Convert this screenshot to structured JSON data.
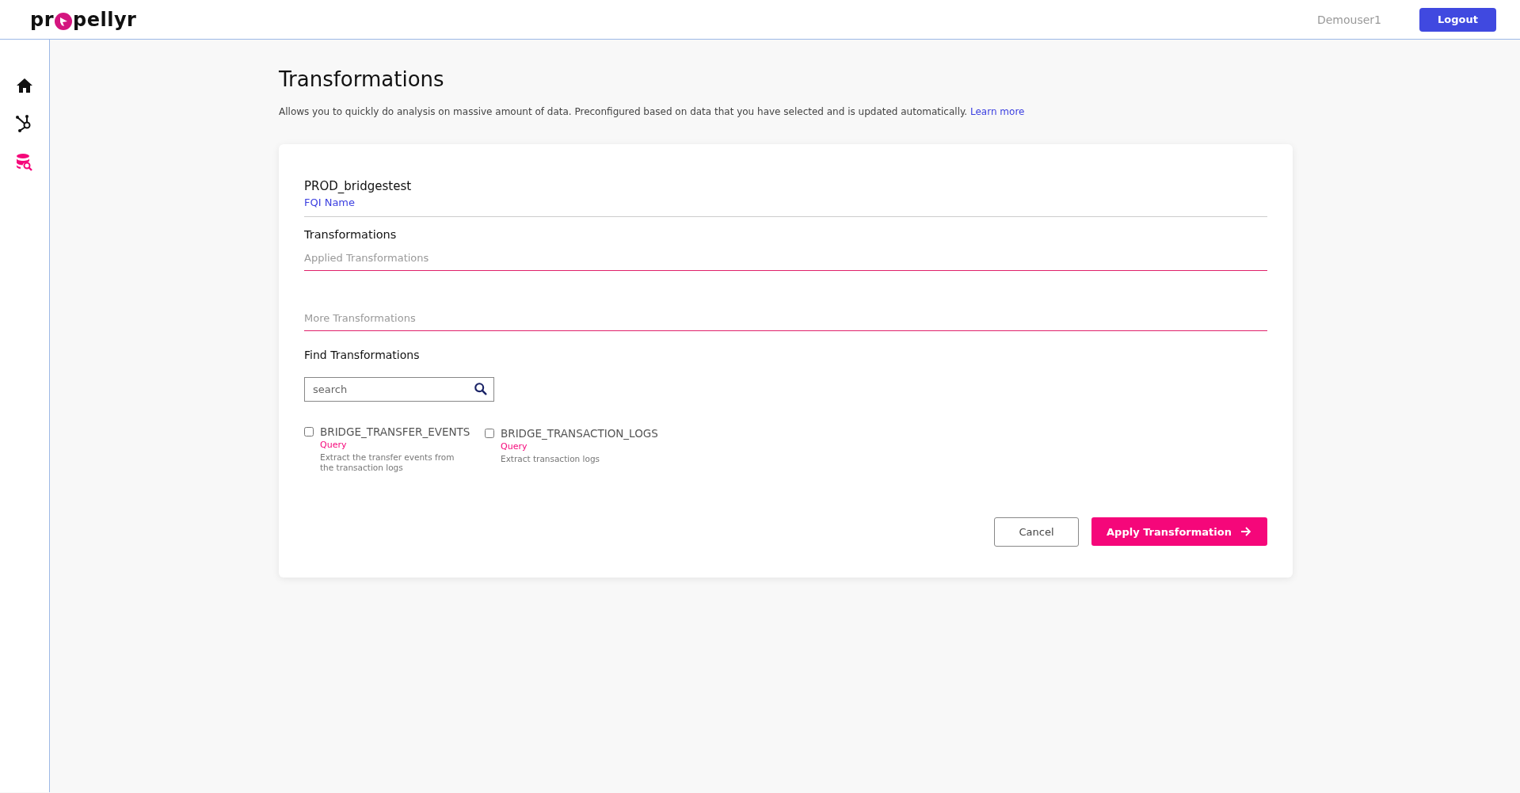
{
  "header": {
    "logo": {
      "before": "pr",
      "after": "pellyr"
    },
    "user": "Demouser1",
    "logout": "Logout"
  },
  "sidebar": {
    "items": [
      {
        "kind": "home",
        "selected": false
      },
      {
        "kind": "hub",
        "selected": false
      },
      {
        "kind": "data-search",
        "selected": true
      }
    ]
  },
  "page": {
    "title": "Transformations",
    "description": "Allows you to quickly do analysis on massive amount of data. Preconfigured based on data that you have selected and is updated automatically.",
    "link": "Learn more"
  },
  "card": {
    "dataset": "PROD_bridgestest",
    "dataset_caption": "FQI Name",
    "section_title": "Transformations",
    "applied_placeholder": "Applied Transformations",
    "more_placeholder": "More Transformations",
    "find_title": "Find Transformations",
    "search": {
      "placeholder": "search"
    },
    "transformations": [
      {
        "name": "BRIDGE_TRANSFER_EVENTS",
        "type": "Query",
        "description": "Extract the transfer events from the transaction logs",
        "checked": false
      },
      {
        "name": "BRIDGE_TRANSACTION_LOGS",
        "type": "Query",
        "description": "Extract transaction logs",
        "checked": false
      }
    ],
    "buttons": {
      "cancel": "Cancel",
      "apply": "Apply Transformation"
    }
  }
}
